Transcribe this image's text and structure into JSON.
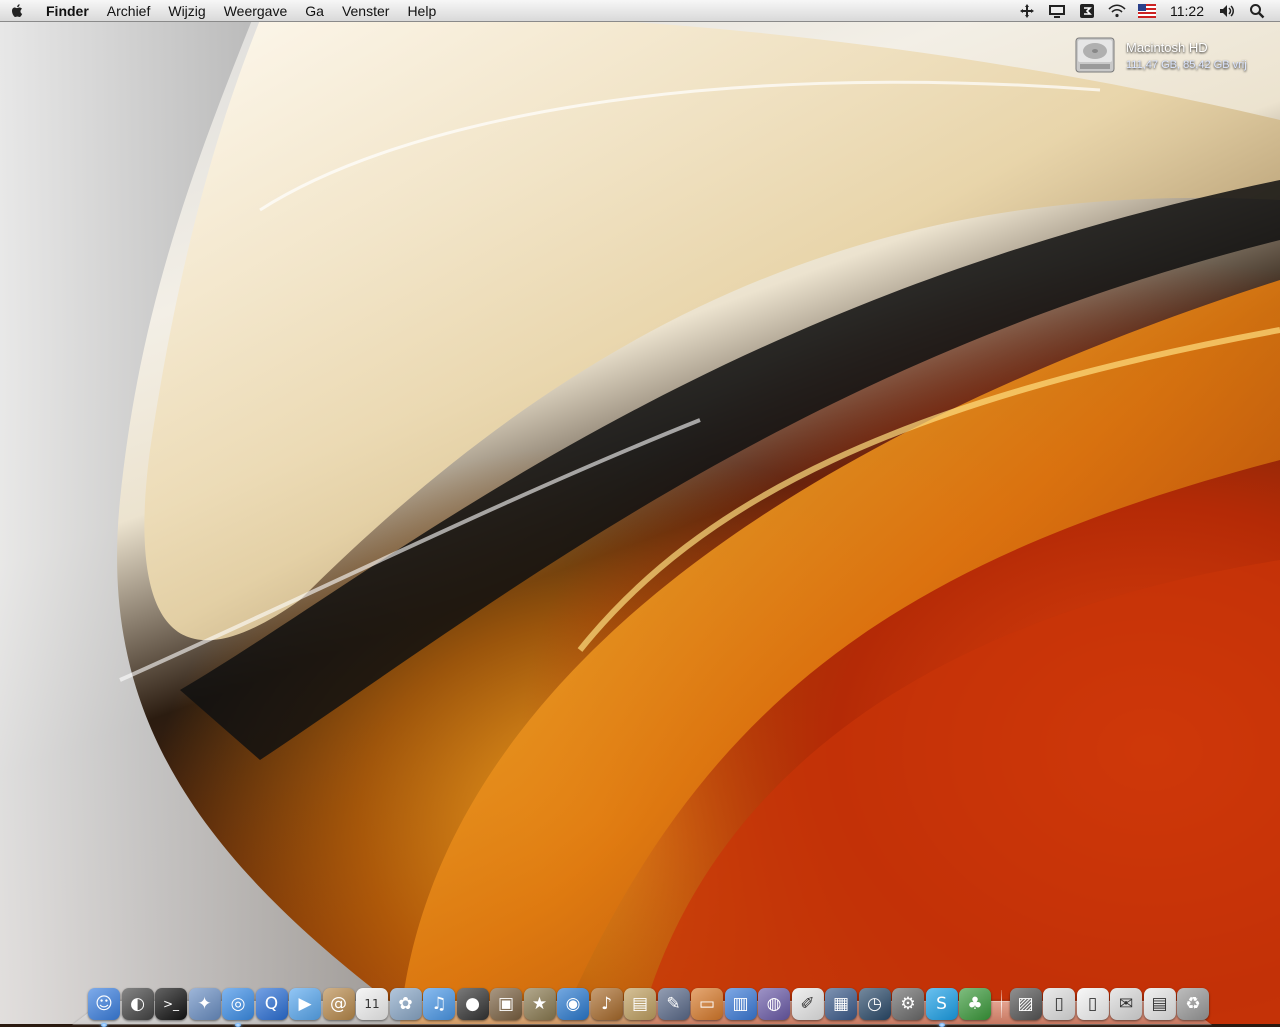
{
  "menubar": {
    "apple_icon": "apple-icon",
    "app_name": "Finder",
    "menus": [
      "Archief",
      "Wijzig",
      "Weergave",
      "Ga",
      "Venster",
      "Help"
    ],
    "status_icons": [
      "move-icon",
      "display-icon",
      "sync-icon",
      "wifi-icon",
      "flag-us-icon",
      "volume-icon",
      "spotlight-icon"
    ],
    "clock": "11:22"
  },
  "desktop": {
    "disk": {
      "name": "Macintosh HD",
      "info": "111,47 GB, 85,42 GB vrij",
      "icon": "hard-drive-icon"
    }
  },
  "dock": {
    "apps": [
      {
        "name": "finder",
        "icon": "finder-icon",
        "glyph": "☺",
        "color": "#3a7fe0",
        "running": true
      },
      {
        "name": "dashboard",
        "icon": "dashboard-icon",
        "glyph": "◐",
        "color": "#444444",
        "running": false
      },
      {
        "name": "terminal",
        "icon": "terminal-icon",
        "glyph": ">_",
        "color": "#111111",
        "running": false
      },
      {
        "name": "preview",
        "icon": "preview-icon",
        "glyph": "✦",
        "color": "#6a8fc4",
        "running": false
      },
      {
        "name": "safari",
        "icon": "safari-icon",
        "glyph": "◎",
        "color": "#3b8ee8",
        "running": true
      },
      {
        "name": "quicktime",
        "icon": "quicktime-icon",
        "glyph": "Q",
        "color": "#2a6fd6",
        "running": false
      },
      {
        "name": "ichat",
        "icon": "ichat-icon",
        "glyph": "▶",
        "color": "#58a8f0",
        "running": false
      },
      {
        "name": "address-book",
        "icon": "address-book-icon",
        "glyph": "@",
        "color": "#b8894a",
        "running": false
      },
      {
        "name": "ical",
        "icon": "calendar-icon",
        "glyph": "11",
        "color": "#f2f2f2",
        "running": false
      },
      {
        "name": "iphoto",
        "icon": "iphoto-icon",
        "glyph": "✿",
        "color": "#8aa8c8",
        "running": false
      },
      {
        "name": "itunes",
        "icon": "itunes-icon",
        "glyph": "♫",
        "color": "#4a98e8",
        "running": false
      },
      {
        "name": "photo-booth",
        "icon": "photo-booth-icon",
        "glyph": "●",
        "color": "#333333",
        "running": false
      },
      {
        "name": "image-capture",
        "icon": "image-capture-icon",
        "glyph": "▣",
        "color": "#7a6040",
        "running": false
      },
      {
        "name": "imovie",
        "icon": "imovie-icon",
        "glyph": "★",
        "color": "#8a7a50",
        "running": false
      },
      {
        "name": "idvd",
        "icon": "idvd-icon",
        "glyph": "◉",
        "color": "#2a7ad0",
        "running": false
      },
      {
        "name": "garageband",
        "icon": "garageband-icon",
        "glyph": "♪",
        "color": "#a86a2a",
        "running": false
      },
      {
        "name": "iweb",
        "icon": "iweb-icon",
        "glyph": "▤",
        "color": "#c0a060",
        "running": false
      },
      {
        "name": "xcode-tools",
        "icon": "drawing-tools-icon",
        "glyph": "✎",
        "color": "#5a6a8a",
        "running": false
      },
      {
        "name": "keynote",
        "icon": "keynote-icon",
        "glyph": "▭",
        "color": "#d87a2a",
        "running": false
      },
      {
        "name": "numbers",
        "icon": "numbers-icon",
        "glyph": "▥",
        "color": "#3a7ad8",
        "running": false
      },
      {
        "name": "itunes-store",
        "icon": "music-disc-icon",
        "glyph": "◍",
        "color": "#6a5aa8",
        "running": false
      },
      {
        "name": "textedit",
        "icon": "textedit-icon",
        "glyph": "✐",
        "color": "#e8e8e8",
        "running": false
      },
      {
        "name": "spaces",
        "icon": "spaces-icon",
        "glyph": "▦",
        "color": "#3a5a8a",
        "running": false
      },
      {
        "name": "time-machine",
        "icon": "time-machine-icon",
        "glyph": "◷",
        "color": "#2a4a6a",
        "running": false
      },
      {
        "name": "system-preferences",
        "icon": "system-preferences-icon",
        "glyph": "⚙",
        "color": "#6a6a6a",
        "running": false
      },
      {
        "name": "skype",
        "icon": "skype-icon",
        "glyph": "S",
        "color": "#1aa0e8",
        "running": true
      },
      {
        "name": "adium",
        "icon": "adium-icon",
        "glyph": "♣",
        "color": "#3a9a3a",
        "running": false
      }
    ],
    "stacks": [
      {
        "name": "photo-stack",
        "icon": "photo-document-icon",
        "glyph": "▨",
        "color": "#555555"
      },
      {
        "name": "pages-document",
        "icon": "pages-document-icon",
        "glyph": "▯",
        "color": "#e0e0e0"
      },
      {
        "name": "blank-document",
        "icon": "document-icon",
        "glyph": "▯",
        "color": "#f4f4f4"
      },
      {
        "name": "mail-document",
        "icon": "mail-document-icon",
        "glyph": "✉",
        "color": "#dcdcdc"
      },
      {
        "name": "spreadsheet-document",
        "icon": "spreadsheet-document-icon",
        "glyph": "▤",
        "color": "#e8e8e8"
      },
      {
        "name": "trash",
        "icon": "trash-icon",
        "glyph": "♻",
        "color": "#9a9a9a"
      }
    ]
  }
}
